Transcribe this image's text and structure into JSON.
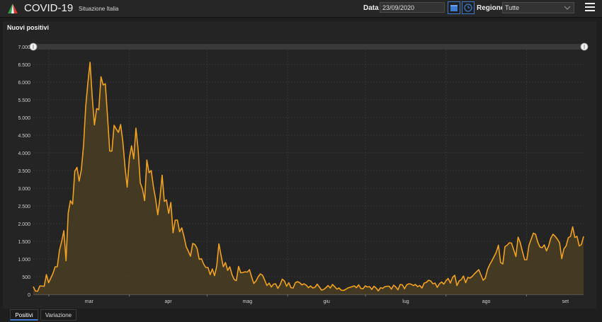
{
  "app": {
    "title": "COVID-19",
    "subtitle": "Situazione Italia"
  },
  "filters": {
    "date_label": "Data",
    "date_value": "23/09/2020",
    "region_label": "Regione",
    "region_value": "Tutte"
  },
  "icons": {
    "logo": "tricolor-logo-icon",
    "calendar": "calendar-icon",
    "clock": "clock-icon",
    "menu": "hamburger-menu-icon",
    "dropdown": "chevron-down-icon"
  },
  "colors": {
    "line": "#f0a21f",
    "area": "#4a3e24",
    "accent": "#3d7bd0",
    "background": "#242424"
  },
  "panel": {
    "title": "Nuovi positivi"
  },
  "tabs": [
    {
      "label": "Positivi",
      "active": true
    },
    {
      "label": "Variazione",
      "active": false
    }
  ],
  "chart_data": {
    "type": "area",
    "title": "Nuovi positivi",
    "ylim": [
      0,
      7000
    ],
    "y_ticks": [
      0,
      500,
      1000,
      1500,
      2000,
      2500,
      3000,
      3500,
      4000,
      4500,
      5000,
      5500,
      6000,
      6500,
      7000
    ],
    "y_tick_labels": [
      "0",
      "500",
      "1.000",
      "1.500",
      "2.000",
      "2.500",
      "3.000",
      "3.500",
      "4.000",
      "4.500",
      "5.000",
      "5.500",
      "6.000",
      "6.500",
      "7.000"
    ],
    "x_range": [
      "2020-02-24",
      "2020-09-23"
    ],
    "x_ticks": [
      {
        "label": "mar",
        "date": "2020-03-01"
      },
      {
        "label": "apr",
        "date": "2020-04-01"
      },
      {
        "label": "mag",
        "date": "2020-05-01"
      },
      {
        "label": "giu",
        "date": "2020-06-01"
      },
      {
        "label": "lug",
        "date": "2020-07-01"
      },
      {
        "label": "ago",
        "date": "2020-08-01"
      },
      {
        "label": "set",
        "date": "2020-09-01"
      }
    ],
    "grid": true,
    "range_slider": true,
    "series": [
      {
        "values": [
          220,
          95,
          90,
          240,
          235,
          230,
          560,
          330,
          460,
          590,
          780,
          780,
          1250,
          1500,
          1800,
          950,
          2300,
          2650,
          2550,
          3480,
          3590,
          3200,
          3520,
          4200,
          5300,
          5980,
          6560,
          5570,
          4790,
          5250,
          5220,
          6150,
          5920,
          5950,
          5020,
          4050,
          4050,
          4780,
          4670,
          4580,
          4800,
          4320,
          3600,
          3030,
          3850,
          4200,
          3830,
          4700,
          4100,
          3150,
          2980,
          2650,
          3800,
          3440,
          3500,
          3050,
          2700,
          2250,
          2720,
          3370,
          2630,
          2670,
          2290,
          2600,
          1740,
          2100,
          2100,
          1770,
          1880,
          1640,
          1350,
          1220,
          1080,
          1440,
          1410,
          1300,
          990,
          1010,
          860,
          760,
          760,
          560,
          720,
          530,
          800,
          1430,
          1100,
          780,
          900,
          680,
          780,
          560,
          420,
          390,
          790,
          610,
          620,
          640,
          630,
          700,
          490,
          310,
          380,
          500,
          580,
          540,
          400,
          250,
          320,
          210,
          290,
          300,
          170,
          270,
          430,
          380,
          230,
          330,
          190,
          180,
          330,
          360,
          330,
          270,
          300,
          260,
          190,
          240,
          180,
          200,
          290,
          210,
          120,
          140,
          190,
          250,
          180,
          280,
          220,
          150,
          180,
          120,
          110,
          140,
          180,
          200,
          220,
          240,
          190,
          270,
          170,
          160,
          240,
          210,
          220,
          140,
          230,
          180,
          100,
          190,
          170,
          220,
          230,
          230,
          150,
          260,
          210,
          130,
          280,
          270,
          160,
          270,
          300,
          290,
          250,
          280,
          220,
          250,
          180,
          320,
          340,
          400,
          380,
          300,
          320,
          200,
          300,
          350,
          290,
          390,
          450,
          320,
          480,
          540,
          250,
          380,
          420,
          520,
          330,
          480,
          460,
          510,
          580,
          640,
          700,
          550,
          400,
          460,
          700,
          840,
          950,
          1070,
          1190,
          1390,
          900,
          860,
          1350,
          1390,
          1460,
          1450,
          1260,
          1070,
          1620,
          1460,
          1210,
          980,
          980,
          1390,
          1560,
          1730,
          1700,
          1480,
          1340,
          1320,
          1400,
          1230,
          1370,
          1590,
          1700,
          1640,
          1560,
          1460,
          1010,
          1290,
          1370,
          1600,
          1640,
          1910,
          1610,
          1640,
          1370,
          1410,
          1640
        ]
      }
    ]
  }
}
